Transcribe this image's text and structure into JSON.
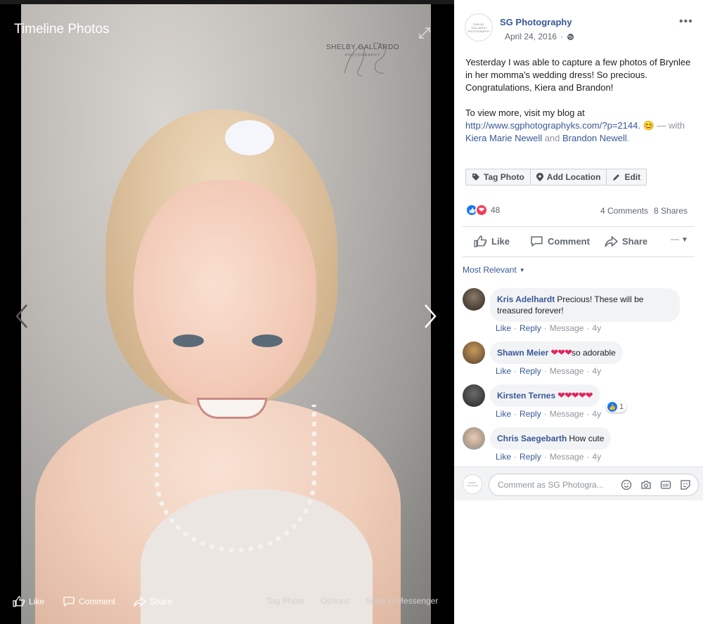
{
  "viewer": {
    "title": "Timeline Photos",
    "watermark": {
      "name": "SHELBY GALLARDO",
      "sub": "PHOTOGRAPHY"
    },
    "bottom": {
      "like": "Like",
      "comment": "Comment",
      "share": "Share",
      "tag": "Tag Photo",
      "options": "Options",
      "send": "Send in Messenger"
    }
  },
  "post": {
    "page_name": "SG Photography",
    "avatar_text": "SHELBY GALLARDO PHOTOGRAPHY",
    "date": "April 24, 2016",
    "text1": "Yesterday I was able to capture a few photos of Brynlee in her momma's wedding dress! So precious. Congratulations, Kiera and Brandon!",
    "text2_prefix": "To view more, visit my blog at ",
    "link": "http://www.sgphotographyks.com/?p=2144.",
    "emoji": "😊",
    "with": " — with ",
    "tag1": "Kiera Marie Newell",
    "and": " and ",
    "tag2": "Brandon Newell",
    "period": "."
  },
  "tools": {
    "tag": "Tag Photo",
    "location": "Add Location",
    "edit": "Edit"
  },
  "stats": {
    "reactions": "48",
    "comments": "4 Comments",
    "shares": "8 Shares"
  },
  "actions": {
    "like": "Like",
    "comment": "Comment",
    "share": "Share"
  },
  "sort_label": "Most Relevant",
  "comments": [
    {
      "name": "Kris Adelhardt",
      "text": "Precious! These will be treasured forever!",
      "like": "Like",
      "reply": "Reply",
      "message": "Message",
      "age": "4y"
    },
    {
      "name": "Shawn Meier",
      "hearts": "❤❤❤",
      "text": "so adorable",
      "like": "Like",
      "reply": "Reply",
      "message": "Message",
      "age": "4y"
    },
    {
      "name": "Kirsten Ternes",
      "hearts": "❤❤❤❤❤",
      "text": "",
      "reactions": "1",
      "like": "Like",
      "reply": "Reply",
      "message": "Message",
      "age": "4y"
    },
    {
      "name": "Chris Saegebarth",
      "text": "How cute",
      "like": "Like",
      "reply": "Reply",
      "message": "Message",
      "age": "4y"
    }
  ],
  "composer": {
    "placeholder": "Comment as SG Photogra...",
    "avatar_text": "SHELBY GALLARDO"
  },
  "colors": {
    "link": "#385898",
    "like_blue": "#1877f2",
    "love_red": "#f33e58",
    "meta_grey": "#90949c"
  },
  "icons": [
    "expand-icon",
    "prev-arrow-icon",
    "next-arrow-icon",
    "thumbs-up-icon",
    "comment-icon",
    "share-icon",
    "globe-icon",
    "more-icon",
    "tag-icon",
    "location-pin-icon",
    "pencil-icon",
    "emoji-icon",
    "camera-icon",
    "gif-icon",
    "sticker-icon"
  ]
}
